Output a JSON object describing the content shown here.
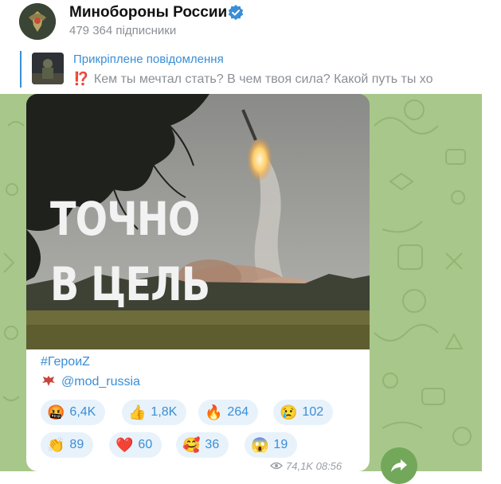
{
  "channel": {
    "title": "Минобороны России",
    "subscribers": "479 364 підписники"
  },
  "pinned": {
    "label": "Прикріплене повідомлення",
    "emoji": "⁉️",
    "text": "Кем ты мечтал стать? В чем твоя сила? Какой путь ты хо"
  },
  "post": {
    "image_text_line1": "ТОЧНО",
    "image_text_line2": "В ЦЕЛЬ",
    "hashtag": "#ГероиZ",
    "signature": "@mod_russia",
    "reactions": [
      {
        "emoji": "🤬",
        "count": "6,4K"
      },
      {
        "emoji": "👍",
        "count": "1,8K"
      },
      {
        "emoji": "🔥",
        "count": "264"
      },
      {
        "emoji": "😢",
        "count": "102"
      },
      {
        "emoji": "👏",
        "count": "89"
      },
      {
        "emoji": "❤️",
        "count": "60"
      },
      {
        "emoji": "🥰",
        "count": "36"
      },
      {
        "emoji": "😱",
        "count": "19"
      }
    ],
    "views": "74,1K",
    "time": "08:56"
  },
  "colors": {
    "accent": "#3a8ed6",
    "chat_background": "#a8c78a",
    "reaction_bg": "#e8f2fb",
    "share_button": "#73a85a"
  },
  "icons": {
    "verified": "verified-badge-icon",
    "views": "eye-icon",
    "share": "share-arrow-icon"
  }
}
